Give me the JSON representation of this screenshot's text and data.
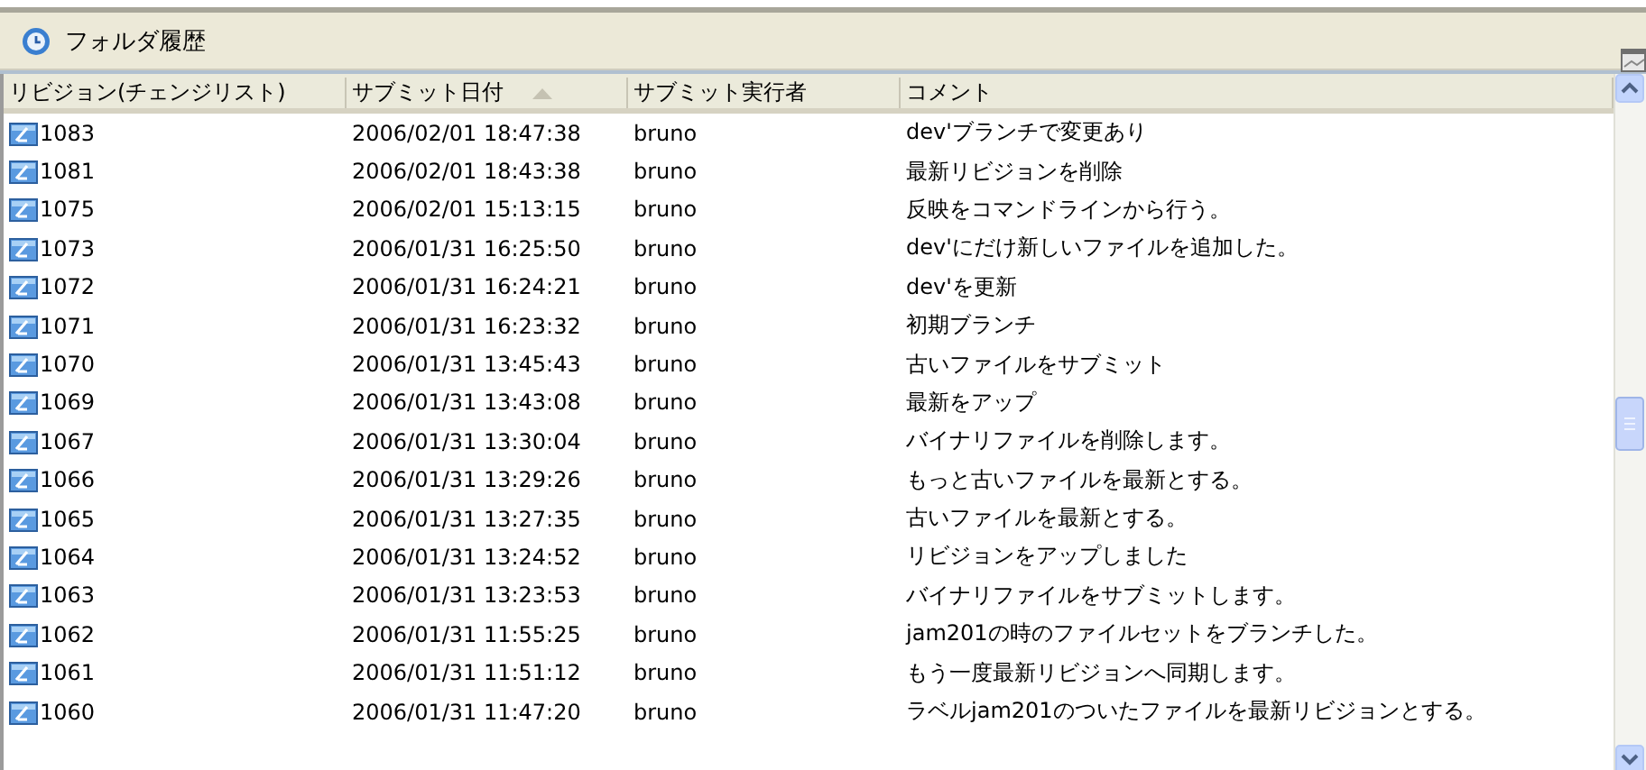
{
  "panel": {
    "title": "フォルダ履歴"
  },
  "table": {
    "columns": [
      {
        "label": "リビジョン(チェンジリスト)",
        "sorted": false
      },
      {
        "label": "サブミット日付",
        "sorted": true
      },
      {
        "label": "サブミット実行者",
        "sorted": false
      },
      {
        "label": "コメント",
        "sorted": false
      }
    ],
    "rows": [
      {
        "revision": "1083",
        "date": "2006/02/01 18:47:38",
        "user": "bruno",
        "comment": "dev'ブランチで変更あり"
      },
      {
        "revision": "1081",
        "date": "2006/02/01 18:43:38",
        "user": "bruno",
        "comment": "最新リビジョンを削除"
      },
      {
        "revision": "1075",
        "date": "2006/02/01 15:13:15",
        "user": "bruno",
        "comment": "反映をコマンドラインから行う。"
      },
      {
        "revision": "1073",
        "date": "2006/01/31 16:25:50",
        "user": "bruno",
        "comment": "dev'にだけ新しいファイルを追加した。"
      },
      {
        "revision": "1072",
        "date": "2006/01/31 16:24:21",
        "user": "bruno",
        "comment": "dev'を更新"
      },
      {
        "revision": "1071",
        "date": "2006/01/31 16:23:32",
        "user": "bruno",
        "comment": "初期ブランチ"
      },
      {
        "revision": "1070",
        "date": "2006/01/31 13:45:43",
        "user": "bruno",
        "comment": "古いファイルをサブミット"
      },
      {
        "revision": "1069",
        "date": "2006/01/31 13:43:08",
        "user": "bruno",
        "comment": "最新をアップ"
      },
      {
        "revision": "1067",
        "date": "2006/01/31 13:30:04",
        "user": "bruno",
        "comment": "バイナリファイルを削除します。"
      },
      {
        "revision": "1066",
        "date": "2006/01/31 13:29:26",
        "user": "bruno",
        "comment": "もっと古いファイルを最新とする。"
      },
      {
        "revision": "1065",
        "date": "2006/01/31 13:27:35",
        "user": "bruno",
        "comment": "古いファイルを最新とする。"
      },
      {
        "revision": "1064",
        "date": "2006/01/31 13:24:52",
        "user": "bruno",
        "comment": "リビジョンをアップしました"
      },
      {
        "revision": "1063",
        "date": "2006/01/31 13:23:53",
        "user": "bruno",
        "comment": "バイナリファイルをサブミットします。"
      },
      {
        "revision": "1062",
        "date": "2006/01/31 11:55:25",
        "user": "bruno",
        "comment": "jam201の時のファイルセットをブランチした。"
      },
      {
        "revision": "1061",
        "date": "2006/01/31 11:51:12",
        "user": "bruno",
        "comment": "もう一度最新リビジョンへ同期します。"
      },
      {
        "revision": "1060",
        "date": "2006/01/31 11:47:20",
        "user": "bruno",
        "comment": "ラベルjam201のついたファイルを最新リビジョンとする。"
      }
    ]
  }
}
